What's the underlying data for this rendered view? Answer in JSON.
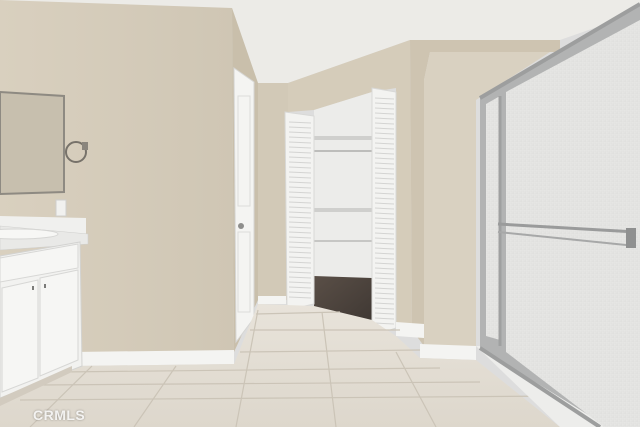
{
  "watermark": {
    "text": "CRMLS"
  },
  "colors": {
    "wall": "#d7cfbf",
    "ceiling": "#ecebe7",
    "trim": "#f4f4f2",
    "floor_tile": "#e2dcd2",
    "grout": "#cfc8bc",
    "closet_carpet": "#4e453f",
    "glass": "#e6e6e4",
    "shower_frame": "#a9aaaa",
    "cabinet": "#f2f2f0"
  },
  "icons": {
    "towel_ring": "towel-ring-icon",
    "door_knob": "door-knob-icon",
    "cabinet_handle": "cabinet-handle-icon"
  }
}
